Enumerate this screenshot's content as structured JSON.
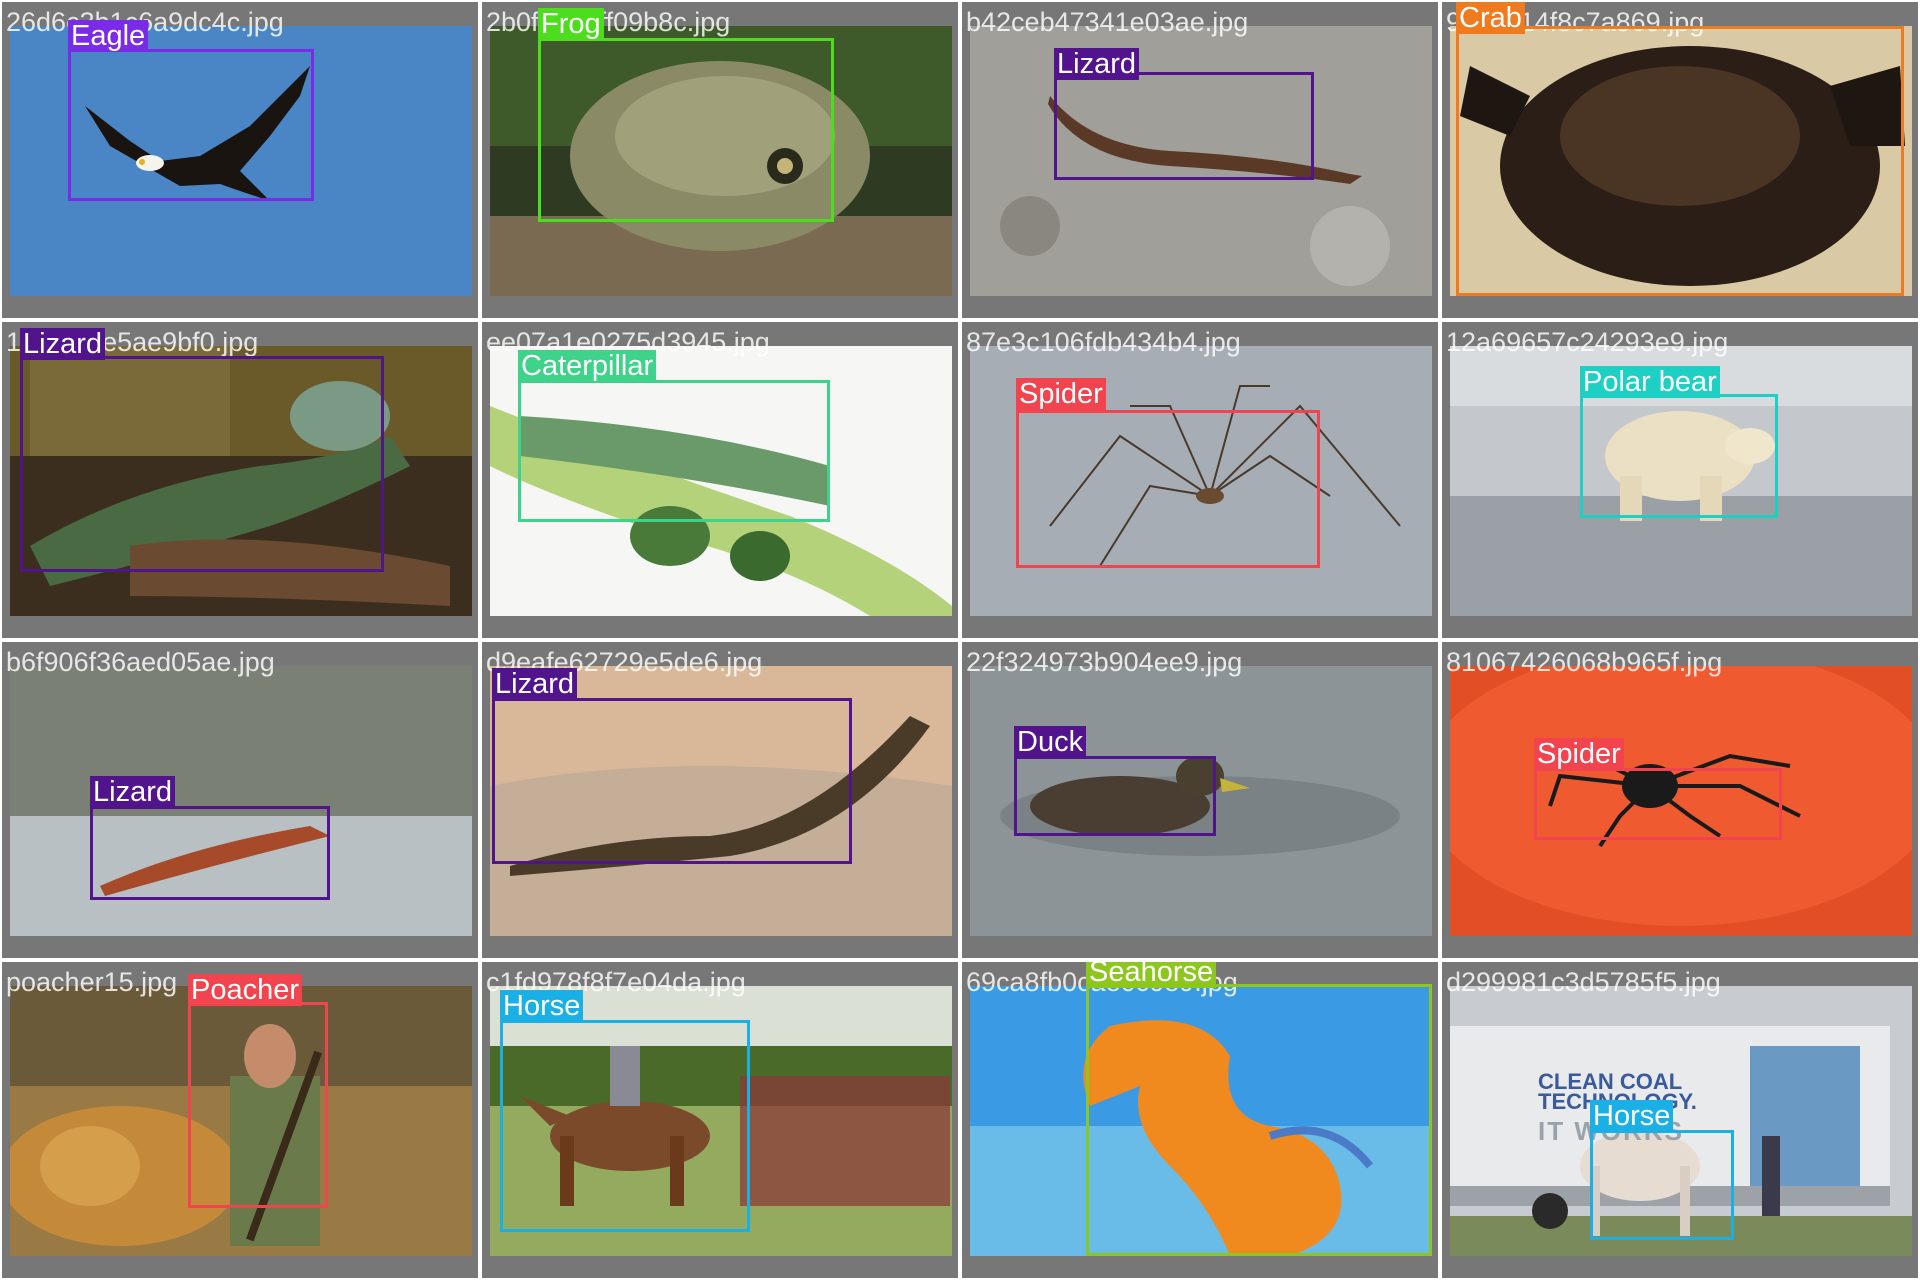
{
  "tiles": [
    {
      "filename": "26d6c3b1c6a9dc4c.jpg",
      "subject": "eagle",
      "bg": "#4a84c4",
      "detections": [
        {
          "label": "Eagle",
          "color": "#7a2be8"
        }
      ]
    },
    {
      "filename": "2b0f1e38ff09b8c.jpg",
      "subject": "frog",
      "bg": "#4c5a3a",
      "detections": [
        {
          "label": "Frog",
          "color": "#4cde1c"
        }
      ]
    },
    {
      "filename": "b42ceb47341e03ae.jpg",
      "subject": "salamander",
      "bg": "#9c9a94",
      "detections": [
        {
          "label": "Lizard",
          "color": "#52148c"
        }
      ]
    },
    {
      "filename": "9c1a214f8c7a869.jpg",
      "subject": "crab",
      "bg": "#d9c9a4",
      "detections": [
        {
          "label": "Crab",
          "color": "#f07a1e"
        }
      ]
    },
    {
      "filename": "1f0c09be5ae9bf0.jpg",
      "subject": "iguana",
      "bg": "#3a2a1a",
      "detections": [
        {
          "label": "Lizard",
          "color": "#52148c"
        }
      ]
    },
    {
      "filename": "ee07a1e0275d3945.jpg",
      "subject": "caterpillar",
      "bg": "#f4f4f2",
      "detections": [
        {
          "label": "Caterpillar",
          "color": "#3fd28a"
        }
      ]
    },
    {
      "filename": "87e3c106fdb434b4.jpg",
      "subject": "spider",
      "bg": "#a4abb3",
      "detections": [
        {
          "label": "Spider",
          "color": "#f2444e"
        }
      ]
    },
    {
      "filename": "12a69657c24293e9.jpg",
      "subject": "polar-bear",
      "bg": "#b8bec3",
      "detections": [
        {
          "label": "Polar bear",
          "color": "#1ed0c3"
        }
      ]
    },
    {
      "filename": "b6f906f36aed05ae.jpg",
      "subject": "newt",
      "bg": "#7c8278",
      "detections": [
        {
          "label": "Lizard",
          "color": "#52148c"
        }
      ]
    },
    {
      "filename": "d9eafe62729e5de6.jpg",
      "subject": "lizard",
      "bg": "#c9a88a",
      "detections": [
        {
          "label": "Lizard",
          "color": "#52148c"
        }
      ]
    },
    {
      "filename": "22f324973b904ee9.jpg",
      "subject": "duck",
      "bg": "#8a9296",
      "detections": [
        {
          "label": "Duck",
          "color": "#52148c"
        }
      ]
    },
    {
      "filename": "81067426068b965f.jpg",
      "subject": "spider-on-plate",
      "bg": "#e8532a",
      "detections": [
        {
          "label": "Spider",
          "color": "#f2444e"
        }
      ]
    },
    {
      "filename": "poacher15.jpg",
      "subject": "poacher",
      "bg": "#8c6a34",
      "detections": [
        {
          "label": "Poacher",
          "color": "#f2444e"
        }
      ]
    },
    {
      "filename": "c1fd978f8f7e04da.jpg",
      "subject": "horse-rider",
      "bg": "#8aa45a",
      "detections": [
        {
          "label": "Horse",
          "color": "#1ab0e6"
        }
      ]
    },
    {
      "filename": "69ca8fb0cae0c0e9.jpg",
      "subject": "seahorse",
      "bg": "#3a9ae4",
      "detections": [
        {
          "label": "Seahorse",
          "color": "#8cc61e"
        }
      ]
    },
    {
      "filename": "d299981c3d5785f5.jpg",
      "subject": "horse-truck",
      "bg": "#c9ccd0",
      "detections": [
        {
          "label": "Horse",
          "color": "#1ab0e6"
        }
      ]
    }
  ],
  "truck_text": {
    "line1": "CLEAN COAL",
    "line2": "TECHNOLOGY.",
    "line3": "IT WORKS"
  }
}
